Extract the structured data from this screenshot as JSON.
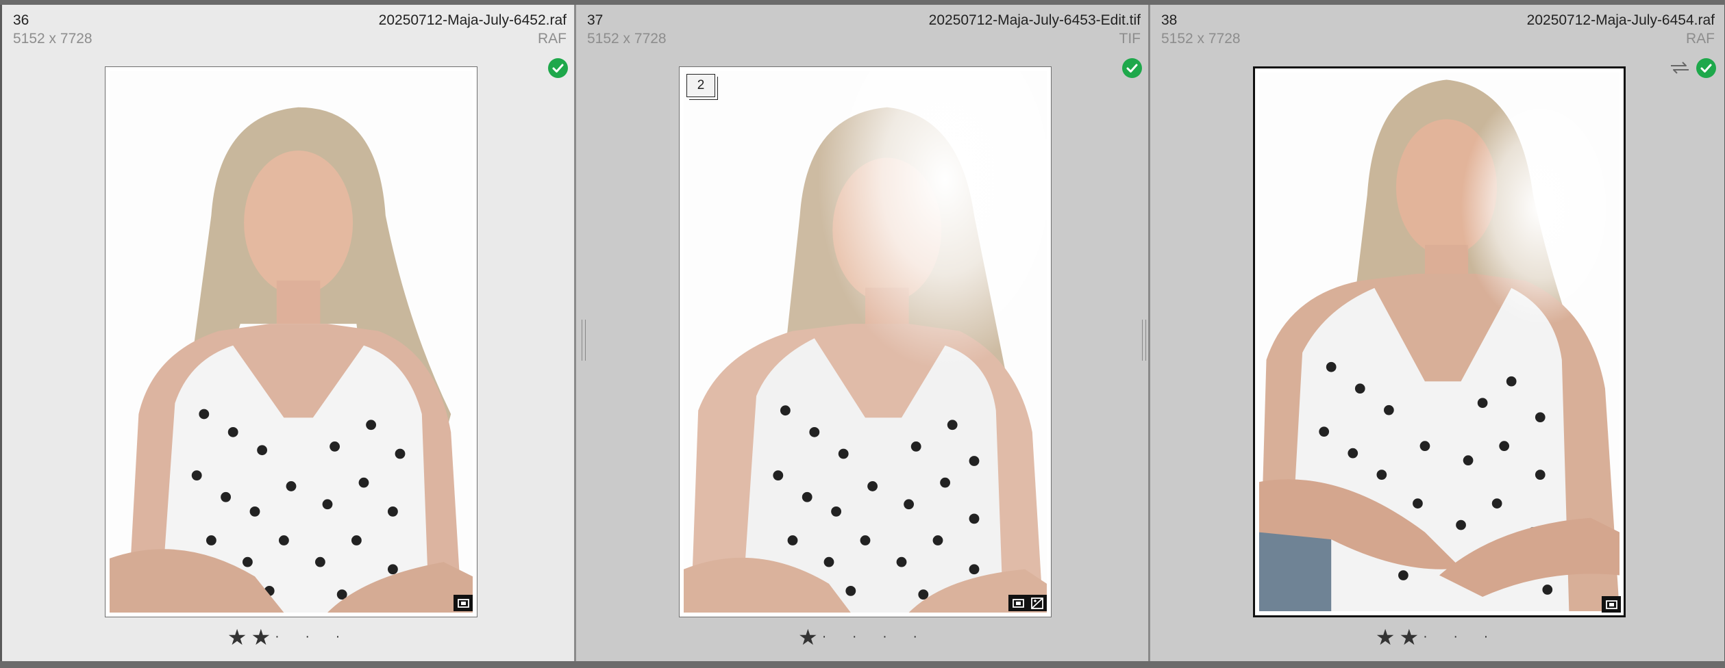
{
  "cells": [
    {
      "index": "36",
      "filename": "20250712-Maja-July-6452.raf",
      "dimensions": "5152 x 7728",
      "filetype": "RAF",
      "rating_stars": "★★",
      "rating_dots": "· · ·",
      "picked": true
    },
    {
      "index": "37",
      "filename": "20250712-Maja-July-6453-Edit.tif",
      "dimensions": "5152 x 7728",
      "filetype": "TIF",
      "stack_count": "2",
      "rating_stars": "★",
      "rating_dots": "· · · ·",
      "picked": true
    },
    {
      "index": "38",
      "filename": "20250712-Maja-July-6454.raf",
      "dimensions": "5152 x 7728",
      "filetype": "RAF",
      "rating_stars": "★★",
      "rating_dots": "· · ·",
      "picked": true
    }
  ],
  "colors": {
    "pick_flag": "#1ea84b",
    "selected_cell": "#eaeaea",
    "cell": "#cacaca"
  },
  "icons": [
    "check-icon",
    "sync-arrows-icon",
    "virtual-copy-icon",
    "develop-adjusted-icon"
  ]
}
